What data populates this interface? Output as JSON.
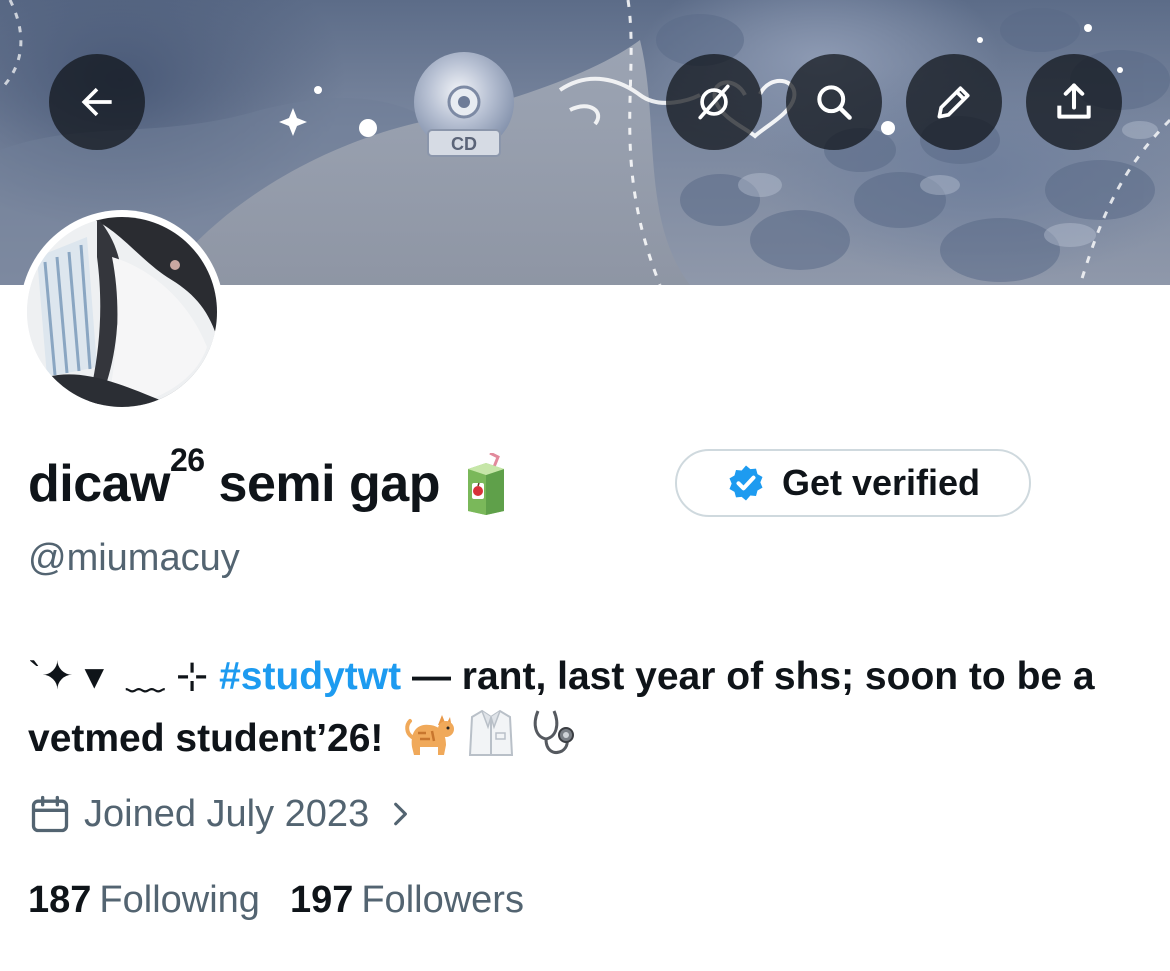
{
  "header": {
    "buttons": [
      {
        "icon": "back-arrow-icon"
      },
      {
        "icon": "grok-icon"
      },
      {
        "icon": "search-icon"
      },
      {
        "icon": "edit-icon"
      },
      {
        "icon": "share-icon"
      }
    ],
    "banner_sticker_text": "CD"
  },
  "profile": {
    "display_name_main": "dicaw",
    "display_name_sup": "26",
    "display_name_rest": " semi gap",
    "display_name_emoji": "juice-box-icon",
    "handle": "@miumacuy",
    "verify_button_label": "Get verified",
    "bio": {
      "ornament": "`✦ ▾  ﹏ ⊹ ",
      "hashtag": "#studytwt",
      "text": " — rant, last year of shs; soon to be a vetmed student’26!",
      "emojis": [
        "cat-icon",
        "lab-coat-icon",
        "stethoscope-icon"
      ]
    },
    "joined": "Joined July 2023",
    "following_count": "187",
    "following_label": "Following",
    "followers_count": "197",
    "followers_label": "Followers"
  },
  "colors": {
    "accent": "#1d9bf0",
    "secondary_text": "#536471",
    "primary_text": "#0f1419",
    "verify_border": "#cfd9de"
  }
}
